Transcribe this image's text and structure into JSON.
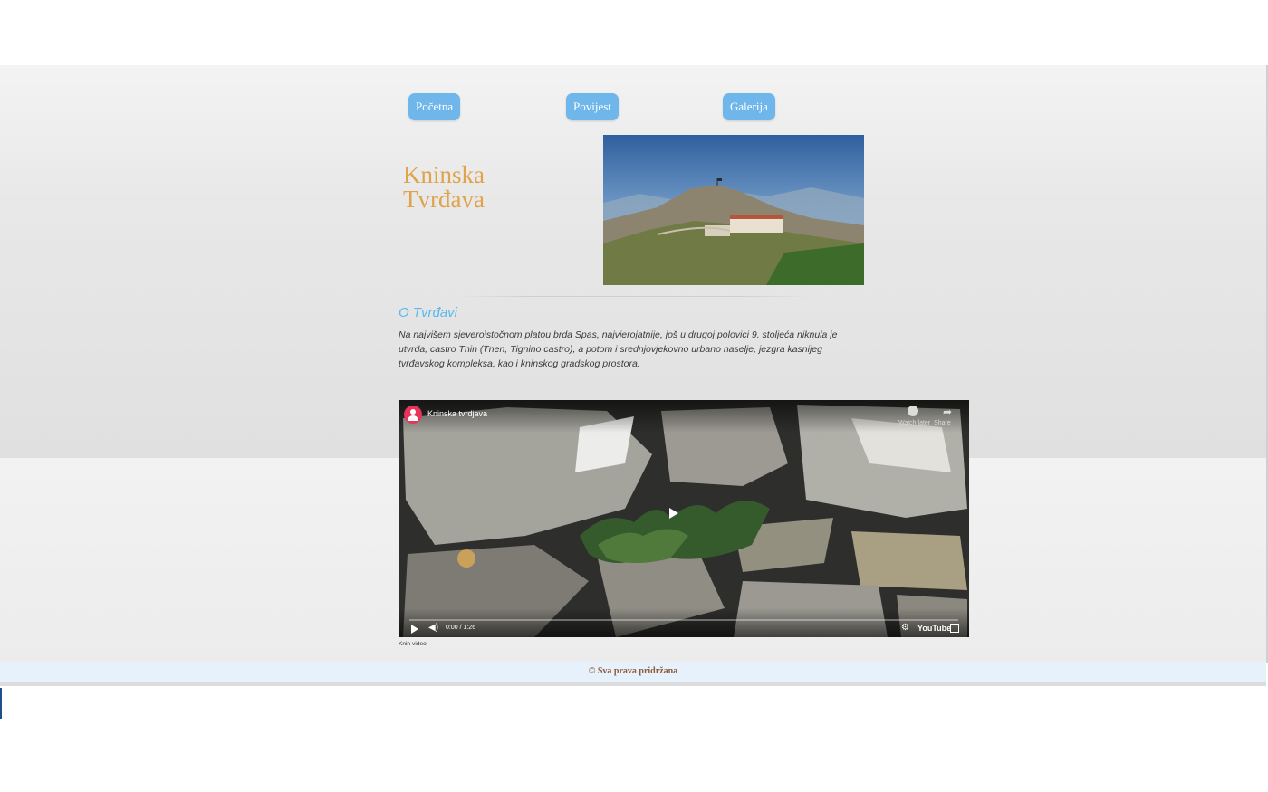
{
  "nav": [
    {
      "label": "Početna"
    },
    {
      "label": "Povijest"
    },
    {
      "label": "Galerija"
    }
  ],
  "hero": {
    "title_line1": "Kninska",
    "title_line2": "Tvrđava"
  },
  "about": {
    "heading": "O Tvrđavi",
    "text": "Na najvišem sjeveroistočnom platou brda Spas, najvjerojatnije, još u drugoj polovici 9. stoljeća niknula je utvrda, castro Tnin (Tnen, Tignino castro), a potom i srednjovjekovno urbano naselje, jezgra kasnijeg tvrđavskog kompleksa, kao i kninskog gradskog prostora."
  },
  "video": {
    "title": "Kninska tvrdjava",
    "watch_later": "Watch later",
    "share": "Share",
    "time": "0:00 / 1:26",
    "youtube": "YouTube",
    "caption": "Knin-video"
  },
  "footer": {
    "text": "© Sva prava pridržana"
  },
  "colors": {
    "nav_button": "#6fb6ea",
    "title": "#e0a24a",
    "heading": "#5ab8ee",
    "footer_bg": "#e7f1fb",
    "footer_text": "#8a5a3a"
  }
}
